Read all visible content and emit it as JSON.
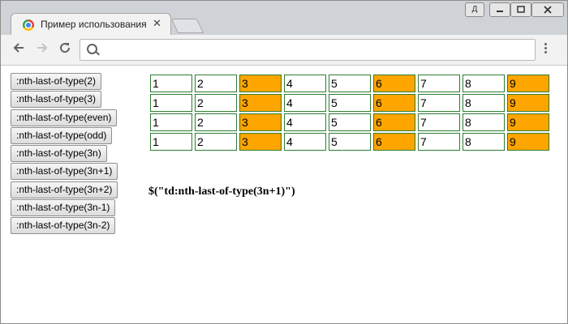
{
  "browser": {
    "tab_title": "Пример использования jQuery",
    "close_glyph": "✕",
    "address_value": "",
    "user_badge": "Д"
  },
  "buttons": [
    ":nth-last-of-type(2)",
    ":nth-last-of-type(3)",
    ":nth-last-of-type(even)",
    ":nth-last-of-type(odd)",
    ":nth-last-of-type(3n)",
    ":nth-last-of-type(3n+1)",
    ":nth-last-of-type(3n+2)",
    ":nth-last-of-type(3n-1)",
    ":nth-last-of-type(3n-2)"
  ],
  "table": {
    "rows": [
      [
        "1",
        "2",
        "3",
        "4",
        "5",
        "6",
        "7",
        "8",
        "9"
      ],
      [
        "1",
        "2",
        "3",
        "4",
        "5",
        "6",
        "7",
        "8",
        "9"
      ],
      [
        "1",
        "2",
        "3",
        "4",
        "5",
        "6",
        "7",
        "8",
        "9"
      ],
      [
        "1",
        "2",
        "3",
        "4",
        "5",
        "6",
        "7",
        "8",
        "9"
      ]
    ],
    "highlighted_columns": [
      3,
      6,
      9
    ],
    "highlight_color": "#ffa500",
    "border_color": "#2e7d32"
  },
  "selector_text": "$(\"td:nth-last-of-type(3n+1)\")"
}
